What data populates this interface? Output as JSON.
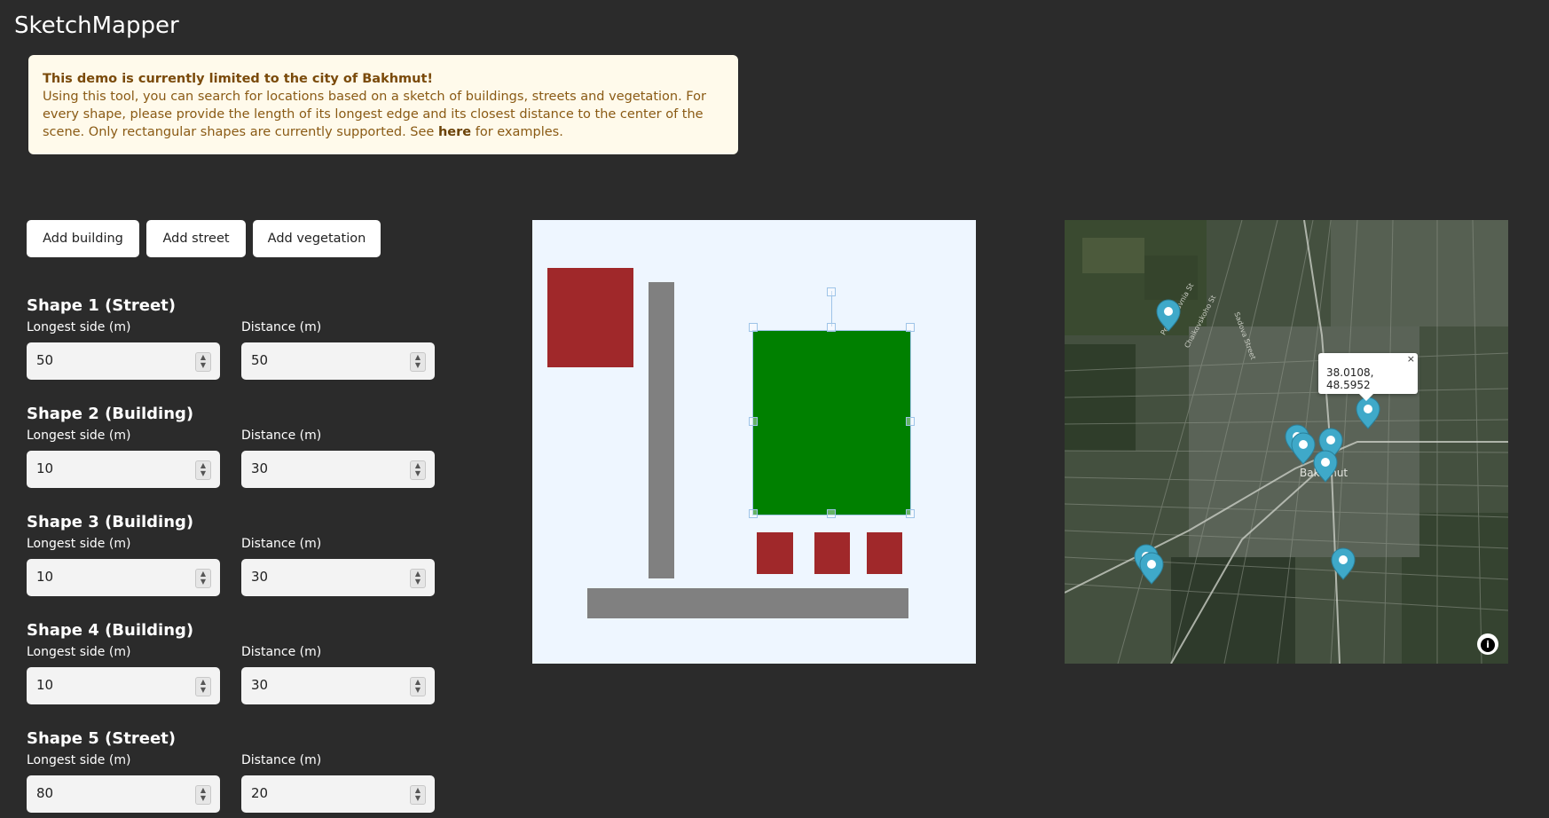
{
  "app": {
    "title": "SketchMapper"
  },
  "notice": {
    "heading": "This demo is currently limited to the city of Bakhmut!",
    "body": "Using this tool, you can search for locations based on a sketch of buildings, streets and vegetation. For every shape, please provide the length of its longest edge and its closest distance to the center of the scene. Only rectangular shapes are currently supported. See",
    "link_text": "here",
    "tail": "for examples."
  },
  "toolbar": {
    "add_building": "Add building",
    "add_street": "Add street",
    "add_vegetation": "Add vegetation"
  },
  "labels": {
    "longest_side": "Longest side (m)",
    "distance": "Distance (m)"
  },
  "shapes": [
    {
      "title": "Shape 1 (Street)",
      "longest_side": "50",
      "distance": "50"
    },
    {
      "title": "Shape 2 (Building)",
      "longest_side": "10",
      "distance": "30"
    },
    {
      "title": "Shape 3 (Building)",
      "longest_side": "10",
      "distance": "30"
    },
    {
      "title": "Shape 4 (Building)",
      "longest_side": "10",
      "distance": "30"
    },
    {
      "title": "Shape 5 (Street)",
      "longest_side": "80",
      "distance": "20"
    }
  ],
  "sketch": {
    "colors": {
      "building": "#a0282a",
      "street": "#808080",
      "vegetation": "#008000",
      "background": "#eef6ff"
    }
  },
  "map": {
    "popup_coordinates": "38.0108, 48.5952",
    "city_label": "Bakhmut",
    "street_labels": [
      "Pershotravnia St",
      "Chaikovskoho St",
      "Sadova Street"
    ],
    "marker_color": "#3fa9c9",
    "info_icon": "info-icon"
  }
}
